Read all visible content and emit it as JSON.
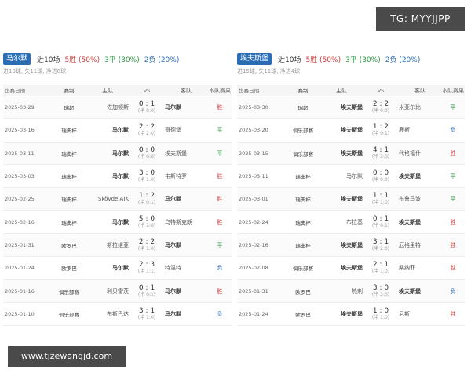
{
  "watermark_top": "TG: MYYJJPP",
  "watermark_bottom": "www.tjzewangjd.com",
  "columns": [
    "比赛日期",
    "赛制",
    "主队",
    "VS",
    "客队",
    "本队赛果"
  ],
  "panels": [
    {
      "team": "马尔默",
      "recent": "近10场",
      "wins": "5胜 (50%)",
      "draws": "3平 (30%)",
      "losses": "2负 (20%)",
      "summary": "进19球, 失11球, 净进8球",
      "rows": [
        {
          "date": "2025-03-29",
          "comp": "瑞超",
          "home": "佐加顿斯",
          "score": "0 : 1",
          "half": "(半 0:0)",
          "away": "马尔默",
          "result": "胜",
          "res": "win",
          "focus": "away"
        },
        {
          "date": "2025-03-16",
          "comp": "瑞典杯",
          "home": "马尔默",
          "score": "2 : 2",
          "half": "(半 2:0)",
          "away": "哥德堡",
          "result": "平",
          "res": "draw",
          "focus": "home"
        },
        {
          "date": "2025-03-11",
          "comp": "瑞典杯",
          "home": "马尔默",
          "score": "0 : 0",
          "half": "(半 0:0)",
          "away": "埃夫斯堡",
          "result": "平",
          "res": "draw",
          "focus": "home"
        },
        {
          "date": "2025-03-03",
          "comp": "瑞典杯",
          "home": "马尔默",
          "score": "3 : 0",
          "half": "(半 1:0)",
          "away": "韦斯特罗",
          "result": "胜",
          "res": "win",
          "focus": "home"
        },
        {
          "date": "2025-02-25",
          "comp": "瑞典杯",
          "home": "Skövde AIK",
          "score": "1 : 2",
          "half": "(半 0:1)",
          "away": "马尔默",
          "result": "胜",
          "res": "win",
          "focus": "away"
        },
        {
          "date": "2025-02-16",
          "comp": "瑞典杯",
          "home": "马尔默",
          "score": "5 : 0",
          "half": "(半 3:0)",
          "away": "乌特斯克朗",
          "result": "胜",
          "res": "win",
          "focus": "home"
        },
        {
          "date": "2025-01-31",
          "comp": "欧罗巴",
          "home": "斯拉维亚",
          "score": "2 : 2",
          "half": "(半 1:0)",
          "away": "马尔默",
          "result": "平",
          "res": "draw",
          "focus": "away"
        },
        {
          "date": "2025-01-24",
          "comp": "欧罗巴",
          "home": "马尔默",
          "score": "2 : 3",
          "half": "(半 1:1)",
          "away": "特温特",
          "result": "负",
          "res": "loss",
          "focus": "home"
        },
        {
          "date": "2025-01-16",
          "comp": "俱乐部赛",
          "home": "利贝雷茨",
          "score": "0 : 1",
          "half": "(半 0:1)",
          "away": "马尔默",
          "result": "胜",
          "res": "win",
          "focus": "away"
        },
        {
          "date": "2025-01-10",
          "comp": "俱乐部赛",
          "home": "布斯巴达",
          "score": "3 : 1",
          "half": "(半 1:0)",
          "away": "马尔默",
          "result": "负",
          "res": "loss",
          "focus": "away"
        }
      ]
    },
    {
      "team": "埃夫斯堡",
      "recent": "近10场",
      "wins": "5胜 (50%)",
      "draws": "3平 (30%)",
      "losses": "2负 (20%)",
      "summary": "进15球, 失11球, 净进4球",
      "rows": [
        {
          "date": "2025-03-30",
          "comp": "瑞超",
          "home": "埃夫斯堡",
          "score": "2 : 2",
          "half": "(半 0:0)",
          "away": "米亚尔比",
          "result": "平",
          "res": "draw",
          "focus": "home"
        },
        {
          "date": "2025-03-20",
          "comp": "俱乐部赛",
          "home": "埃夫斯堡",
          "score": "1 : 2",
          "half": "(半 0:1)",
          "away": "鹿斯",
          "result": "负",
          "res": "loss",
          "focus": "home"
        },
        {
          "date": "2025-03-15",
          "comp": "俱乐部赛",
          "home": "埃夫斯堡",
          "score": "4 : 1",
          "half": "(半 3:0)",
          "away": "代格福什",
          "result": "胜",
          "res": "win",
          "focus": "home"
        },
        {
          "date": "2025-03-11",
          "comp": "瑞典杯",
          "home": "马尔默",
          "score": "0 : 0",
          "half": "(半 0:0)",
          "away": "埃夫斯堡",
          "result": "平",
          "res": "draw",
          "focus": "away"
        },
        {
          "date": "2025-03-01",
          "comp": "瑞典杯",
          "home": "埃夫斯堡",
          "score": "1 : 1",
          "half": "(半 1:0)",
          "away": "布鲁马波",
          "result": "平",
          "res": "draw",
          "focus": "home"
        },
        {
          "date": "2025-02-24",
          "comp": "瑞典杯",
          "home": "布拉基",
          "score": "0 : 1",
          "half": "(半 0:1)",
          "away": "埃夫斯堡",
          "result": "胜",
          "res": "win",
          "focus": "away"
        },
        {
          "date": "2025-02-16",
          "comp": "瑞典杯",
          "home": "埃夫斯堡",
          "score": "3 : 1",
          "half": "(半 2:0)",
          "away": "厄格里特",
          "result": "胜",
          "res": "win",
          "focus": "home"
        },
        {
          "date": "2025-02-08",
          "comp": "俱乐部赛",
          "home": "埃夫斯堡",
          "score": "2 : 1",
          "half": "(半 1:0)",
          "away": "桑纳菲",
          "result": "胜",
          "res": "win",
          "focus": "home"
        },
        {
          "date": "2025-01-31",
          "comp": "欧罗巴",
          "home": "热刺",
          "score": "3 : 0",
          "half": "(半 2:0)",
          "away": "埃夫斯堡",
          "result": "负",
          "res": "loss",
          "focus": "away"
        },
        {
          "date": "2025-01-24",
          "comp": "欧罗巴",
          "home": "埃夫斯堡",
          "score": "1 : 0",
          "half": "(半 1:0)",
          "away": "尼斯",
          "result": "胜",
          "res": "win",
          "focus": "home"
        }
      ]
    }
  ]
}
